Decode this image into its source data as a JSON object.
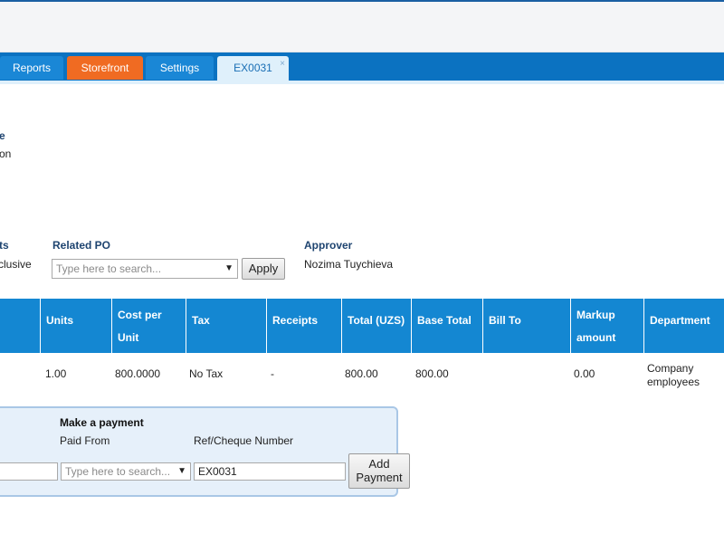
{
  "tabs": [
    {
      "label": "Reports"
    },
    {
      "label": "Storefront"
    },
    {
      "label": "Settings"
    },
    {
      "label": "EX0031",
      "close": "×"
    }
  ],
  "header_fragments": {
    "title_fragment": "e",
    "subtitle_fragment": "on"
  },
  "fields": {
    "amounts_label_fragment": "ts",
    "amounts_value_fragment": "clusive",
    "related_po_label": "Related PO",
    "related_po_placeholder": "Type here to search...",
    "apply_label": "Apply",
    "approver_label": "Approver",
    "approver_value": "Nozima Tuychieva"
  },
  "table": {
    "headers": [
      {
        "lines": [
          "Units"
        ]
      },
      {
        "lines": [
          "Cost per",
          "Unit"
        ]
      },
      {
        "lines": [
          "Tax"
        ]
      },
      {
        "lines": [
          "Receipts"
        ]
      },
      {
        "lines": [
          "Total (UZS)"
        ]
      },
      {
        "lines": [
          "Base Total"
        ]
      },
      {
        "lines": [
          "Bill To"
        ]
      },
      {
        "lines": [
          "Markup",
          "amount"
        ]
      },
      {
        "lines": [
          "Department"
        ]
      }
    ],
    "row": {
      "units": "1.00",
      "cost_per_unit": "800.0000",
      "tax": "No Tax",
      "receipts": "-",
      "total": "800.00",
      "base_total": "800.00",
      "bill_to": "",
      "markup_amount": "0.00",
      "department_line1": "Company",
      "department_line2": "employees"
    }
  },
  "payment": {
    "title": "Make a payment",
    "paid_from_label": "Paid From",
    "ref_label": "Ref/Cheque Number",
    "amount_value": "",
    "paid_from_placeholder": "Type here to search...",
    "ref_value": "EX0031",
    "add_payment_line1": "Add",
    "add_payment_line2": "Payment"
  },
  "colors": {
    "tabbar": "#0b72c1",
    "storefront_tab": "#f06b22",
    "table_header": "#1487d2",
    "label": "#1e4470"
  }
}
